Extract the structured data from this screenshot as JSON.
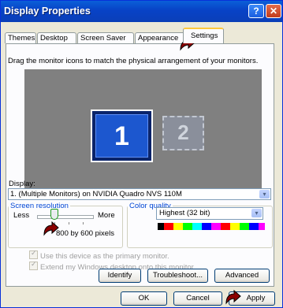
{
  "window": {
    "title": "Display Properties",
    "help_label": "?",
    "close_label": "✕"
  },
  "tabs": [
    {
      "label": "Themes"
    },
    {
      "label": "Desktop"
    },
    {
      "label": "Screen Saver"
    },
    {
      "label": "Appearance"
    },
    {
      "label": "Settings"
    }
  ],
  "settings": {
    "instruction": "Drag the monitor icons to match the physical arrangement of your monitors.",
    "monitor1_label": "1",
    "monitor2_label": "2",
    "display_label": "Display:",
    "display_value": "1. (Multiple Monitors) on NVIDIA Quadro NVS 110M",
    "resolution": {
      "legend": "Screen resolution",
      "less": "Less",
      "more": "More",
      "value": "800 by 600 pixels"
    },
    "color": {
      "legend": "Color quality",
      "value": "Highest (32 bit)"
    },
    "check_primary": "Use this device as the primary monitor.",
    "check_extend": "Extend my Windows desktop onto this monitor.",
    "buttons": {
      "identify": "Identify",
      "troubleshoot": "Troubleshoot...",
      "advanced": "Advanced"
    }
  },
  "dialog_buttons": {
    "ok": "OK",
    "cancel": "Cancel",
    "apply": "Apply"
  },
  "icons": {
    "dropdown": "▾",
    "cursor": "pointing-hand-cursor-icon"
  },
  "colors": {
    "titlebar": "#0842c6",
    "dialog": "#ece9d8",
    "monitor_area": "#808080",
    "primary_monitor": "#1c57cf",
    "accent_text": "#0046d5"
  }
}
